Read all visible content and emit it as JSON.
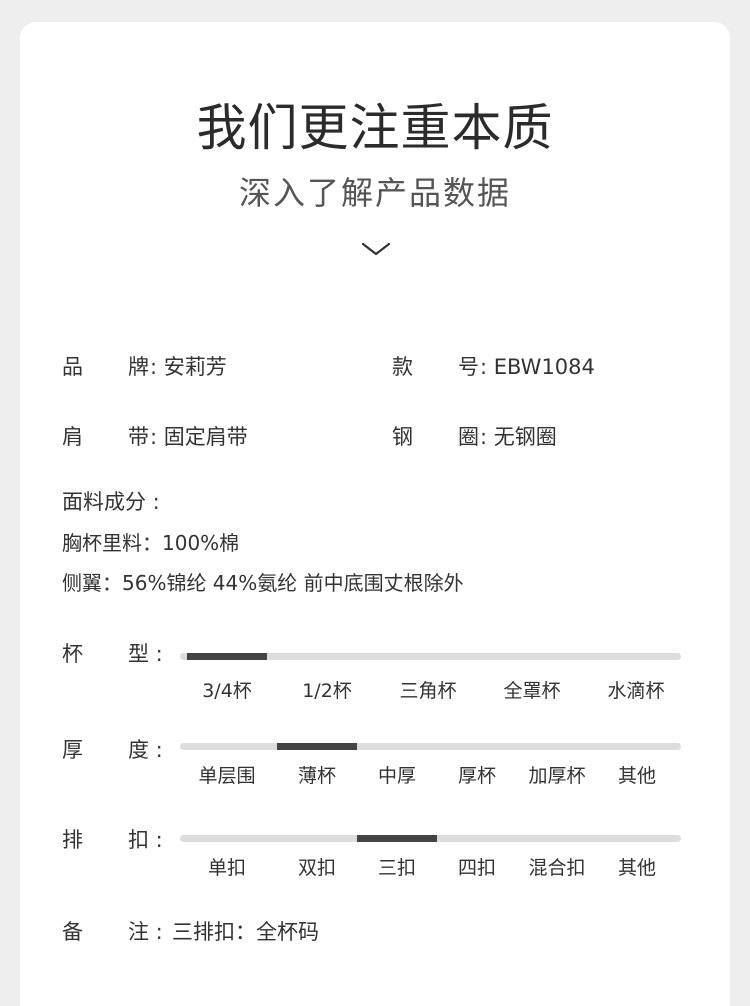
{
  "header": {
    "title": "我们更注重本质",
    "subtitle": "深入了解产品数据",
    "chevron_icon": "chevron-down-icon"
  },
  "specs": {
    "brand": {
      "label_a": "品",
      "label_b": "牌",
      "value": ": 安莉芳"
    },
    "model": {
      "label_a": "款",
      "label_b": "号",
      "value": ": EBW1084"
    },
    "strap": {
      "label_a": "肩",
      "label_b": "带",
      "value": ": 固定肩带"
    },
    "wire": {
      "label_a": "钢",
      "label_b": "圈",
      "value": ": 无钢圈"
    }
  },
  "fabric": {
    "heading": "面料成分 :",
    "lines": [
      "胸杯里料：100%棉",
      "侧翼：56%锦纶 44%氨纶 前中底围丈根除外"
    ]
  },
  "scales": [
    {
      "label_a": "杯",
      "label_b": "型 :",
      "options": [
        "3/4杯",
        "1/2杯",
        "三角杯",
        "全罩杯",
        "水滴杯"
      ],
      "selected_index": 0
    },
    {
      "label_a": "厚",
      "label_b": "度 :",
      "options": [
        "单层围",
        "薄杯",
        "中厚",
        "厚杯",
        "加厚杯",
        "其他"
      ],
      "selected_index": 1
    },
    {
      "label_a": "排",
      "label_b": "扣 :",
      "options": [
        "单扣",
        "双扣",
        "三扣",
        "四扣",
        "混合扣",
        "其他"
      ],
      "selected_index": 2
    }
  ],
  "note": {
    "label_a": "备",
    "label_b": "注 :",
    "value": "三排扣：全杯码"
  },
  "colors": {
    "track": "#dddddd",
    "indicator": "#444444",
    "card": "#ffffff",
    "background": "#eeeeee"
  }
}
